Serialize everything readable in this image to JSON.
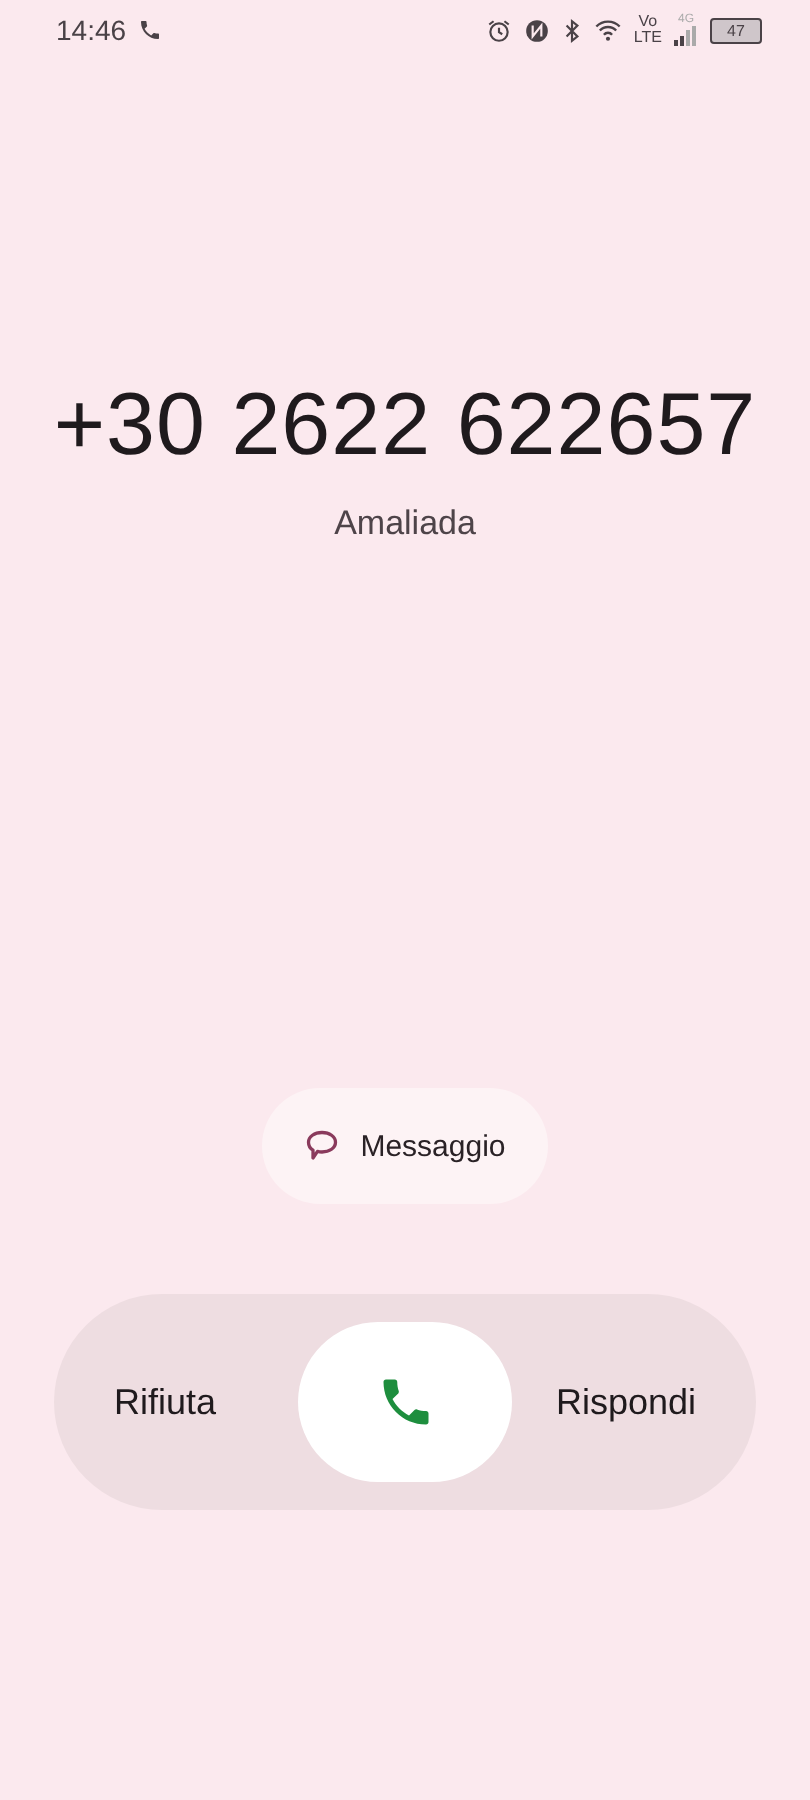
{
  "status_bar": {
    "time": "14:46",
    "volte_top": "Vo",
    "volte_bottom": "LTE",
    "network": "4G",
    "battery": "47"
  },
  "caller": {
    "number": "+30 2622 622657",
    "location": "Amaliada"
  },
  "message_button": {
    "label": "Messaggio"
  },
  "answer_slider": {
    "decline_label": "Rifiuta",
    "answer_label": "Rispondi",
    "level": 0.5
  }
}
